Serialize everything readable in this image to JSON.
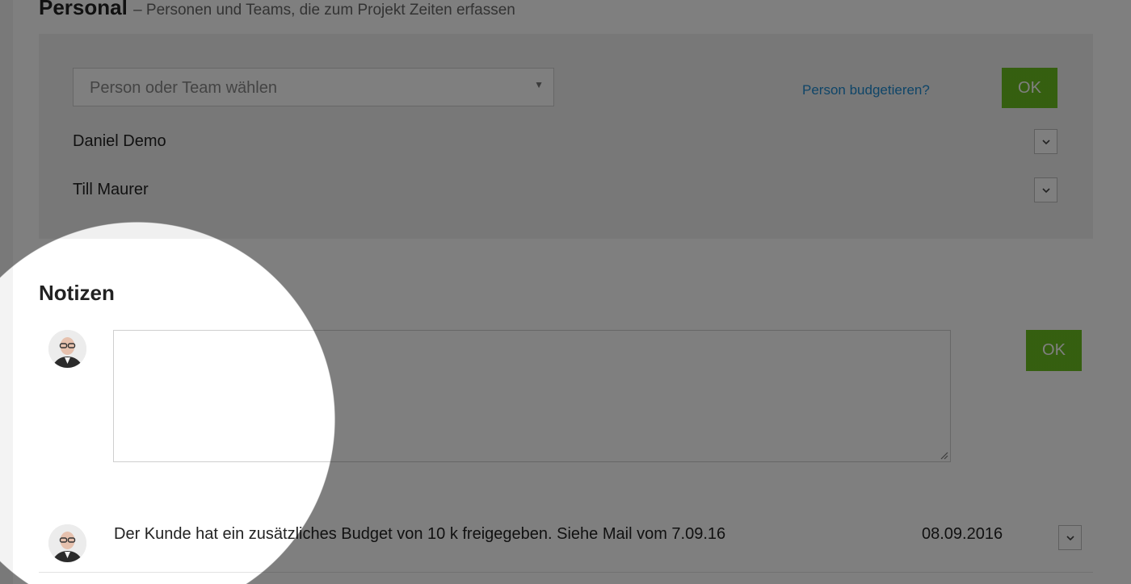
{
  "personal": {
    "title": "Personal",
    "subtitle": "– Personen und Teams, die zum Projekt Zeiten erfassen",
    "select_placeholder": "Person oder Team wählen",
    "budget_link": "Person budgetieren?",
    "ok_label": "OK",
    "people": [
      {
        "name": "Daniel Demo"
      },
      {
        "name": "Till Maurer"
      }
    ]
  },
  "notes": {
    "title": "Notizen",
    "ok_label": "OK",
    "textarea_value": "",
    "items": [
      {
        "text": "Der Kunde hat ein zusätzliches Budget von 10 k freigegeben. Siehe Mail vom 7.09.16",
        "date": "08.09.2016"
      }
    ]
  },
  "colors": {
    "accent": "#6bbf1f",
    "link": "#1e8bd1"
  },
  "icons": {
    "dropdown": "chevron-down-icon",
    "select_arrow": "caret-down-icon",
    "avatar": "user-avatar",
    "resize": "resize-grip-icon"
  }
}
